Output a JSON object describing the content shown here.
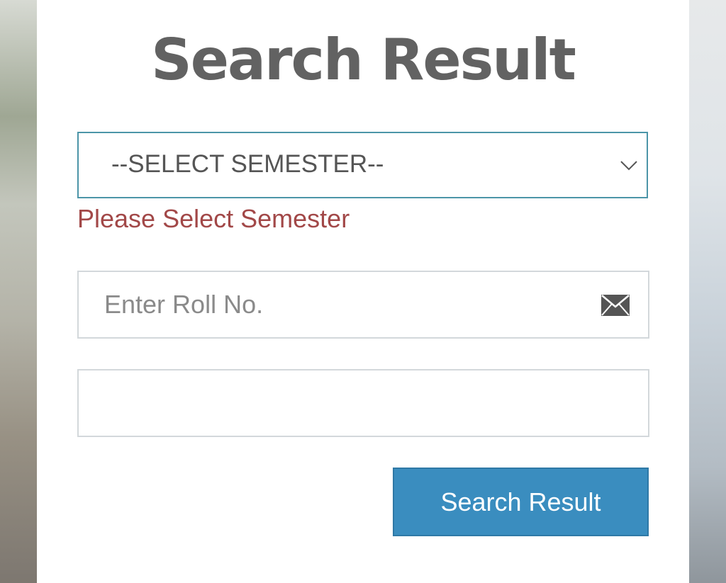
{
  "form": {
    "title": "Search Result",
    "semester_select": {
      "selected": "--SELECT SEMESTER--",
      "icon": "chevron-down-icon"
    },
    "semester_error": "Please Select Semester",
    "roll_input": {
      "value": "",
      "placeholder": "Enter Roll No.",
      "icon": "envelope-icon"
    },
    "second_input": {
      "value": "",
      "placeholder": ""
    },
    "submit_label": "Search Result"
  },
  "colors": {
    "title": "#626262",
    "error": "#a24848",
    "select_border": "#4c95a8",
    "input_border": "#d3d8db",
    "button": "#3a8dbf"
  }
}
